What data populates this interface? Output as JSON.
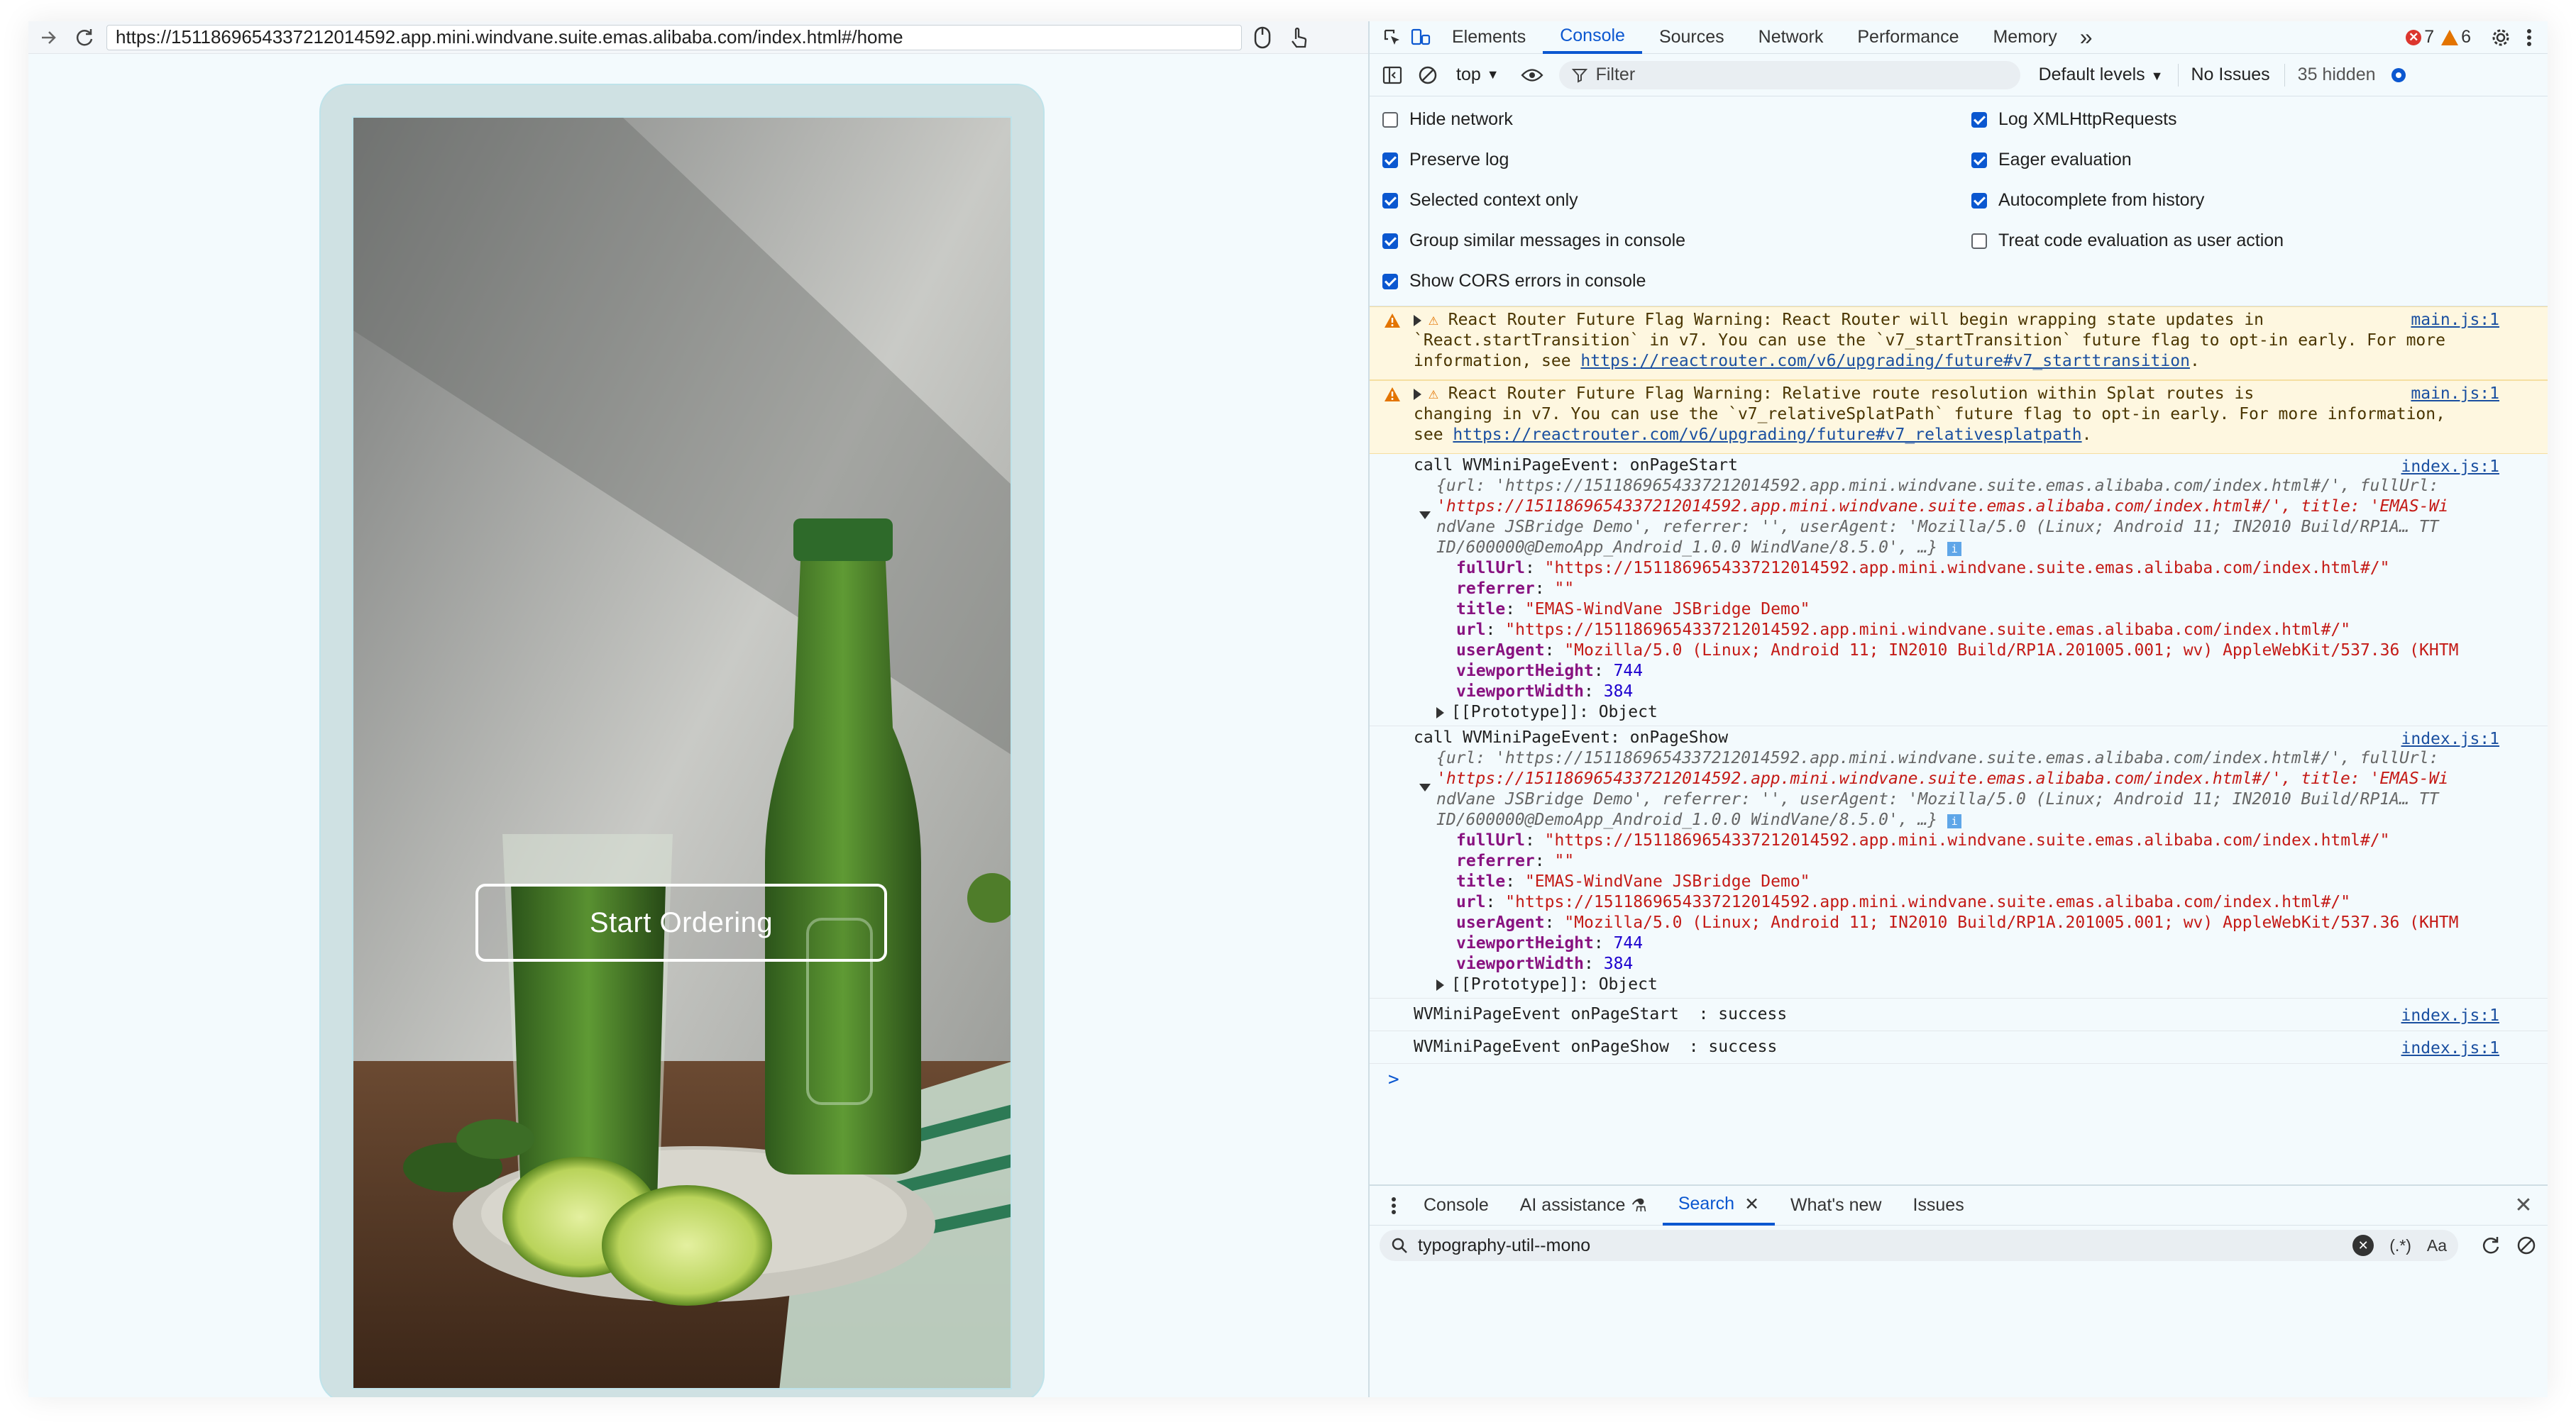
{
  "browser": {
    "url": "https://1511869654337212014592.app.mini.windvane.suite.emas.alibaba.com/index.html#/home"
  },
  "page": {
    "start_button": "Start Ordering",
    "image_alt": "green juice bottle with glass and limes"
  },
  "devtools": {
    "tabs": [
      "Elements",
      "Console",
      "Sources",
      "Network",
      "Performance",
      "Memory"
    ],
    "active_tab": "Console",
    "more_tabs": "»",
    "errors": "7",
    "warnings": "6",
    "context": "top",
    "filter_placeholder": "Filter",
    "levels": "Default levels",
    "no_issues": "No Issues",
    "hidden": "35 hidden",
    "settings": [
      {
        "label": "Hide network",
        "checked": false
      },
      {
        "label": "Preserve log",
        "checked": true
      },
      {
        "label": "Selected context only",
        "checked": true
      },
      {
        "label": "Group similar messages in console",
        "checked": true
      },
      {
        "label": "Show CORS errors in console",
        "checked": true
      },
      {
        "label": "Log XMLHttpRequests",
        "checked": true
      },
      {
        "label": "Eager evaluation",
        "checked": true
      },
      {
        "label": "Autocomplete from history",
        "checked": true
      },
      {
        "label": "Treat code evaluation as user action",
        "checked": false
      }
    ],
    "warnings_list": [
      {
        "text1": "React Router Future Flag Warning: React Router will begin wrapping state updates in",
        "text2": "`React.startTransition` in v7. You can use the `v7_startTransition` future flag to opt-in early. For more",
        "text3": "information, see",
        "link": "https://reactrouter.com/v6/upgrading/future#v7_starttransition",
        "source": "main.js:1"
      },
      {
        "text1": "React Router Future Flag Warning: Relative route resolution within Splat routes is",
        "text2": "changing in v7. You can use the `v7_relativeSplatPath` future flag to opt-in early. For more information,",
        "text3": "see",
        "link": "https://reactrouter.com/v6/upgrading/future#v7_relativesplatpath",
        "source": "main.js:1"
      }
    ],
    "events": [
      {
        "title": "call WVMiniPageEvent: onPageStart",
        "source": "index.js:1",
        "summary1": "{url: 'https://1511869654337212014592.app.mini.windvane.suite.emas.alibaba.com/index.html#/', fullUrl:",
        "summary2": "'https://1511869654337212014592.app.mini.windvane.suite.emas.alibaba.com/index.html#/', title: 'EMAS-Wi",
        "summary3": "ndVane JSBridge Demo', referrer: '', userAgent: 'Mozilla/5.0 (Linux; Android 11; IN2010 Build/RP1A… TT",
        "summary4": "ID/600000@DemoApp_Android_1.0.0 WindVane/8.5.0', …}",
        "fullUrl": "\"https://1511869654337212014592.app.mini.windvane.suite.emas.alibaba.com/index.html#/\"",
        "referrer": "\"\"",
        "title_val": "\"EMAS-WindVane JSBridge Demo\"",
        "url": "\"https://1511869654337212014592.app.mini.windvane.suite.emas.alibaba.com/index.html#/\"",
        "userAgent": "\"Mozilla/5.0 (Linux; Android 11; IN2010 Build/RP1A.201005.001; wv) AppleWebKit/537.36 (KHTM",
        "viewportHeight": "744",
        "viewportWidth": "384",
        "prototype": "[[Prototype]]: Object"
      },
      {
        "title": "call WVMiniPageEvent: onPageShow",
        "source": "index.js:1",
        "summary1": "{url: 'https://1511869654337212014592.app.mini.windvane.suite.emas.alibaba.com/index.html#/', fullUrl:",
        "summary2": "'https://1511869654337212014592.app.mini.windvane.suite.emas.alibaba.com/index.html#/', title: 'EMAS-Wi",
        "summary3": "ndVane JSBridge Demo', referrer: '', userAgent: 'Mozilla/5.0 (Linux; Android 11; IN2010 Build/RP1A… TT",
        "summary4": "ID/600000@DemoApp_Android_1.0.0 WindVane/8.5.0', …}",
        "fullUrl": "\"https://1511869654337212014592.app.mini.windvane.suite.emas.alibaba.com/index.html#/\"",
        "referrer": "\"\"",
        "title_val": "\"EMAS-WindVane JSBridge Demo\"",
        "url": "\"https://1511869654337212014592.app.mini.windvane.suite.emas.alibaba.com/index.html#/\"",
        "userAgent": "\"Mozilla/5.0 (Linux; Android 11; IN2010 Build/RP1A.201005.001; wv) AppleWebKit/537.36 (KHTM",
        "viewportHeight": "744",
        "viewportWidth": "384",
        "prototype": "[[Prototype]]: Object"
      }
    ],
    "results": [
      {
        "text": "WVMiniPageEvent onPageStart  : success",
        "source": "index.js:1"
      },
      {
        "text": "WVMiniPageEvent onPageShow  : success",
        "source": "index.js:1"
      }
    ],
    "prompt": ">",
    "drawer_tabs": [
      "Console",
      "AI assistance",
      "Search",
      "What's new",
      "Issues"
    ],
    "drawer_active": "Search",
    "search_value": "typography-util--mono",
    "search_regex": "(.*)",
    "search_case": "Aa"
  },
  "colors": {
    "accent": "#0b57d0",
    "error": "#dc362e",
    "warning": "#e37400"
  }
}
